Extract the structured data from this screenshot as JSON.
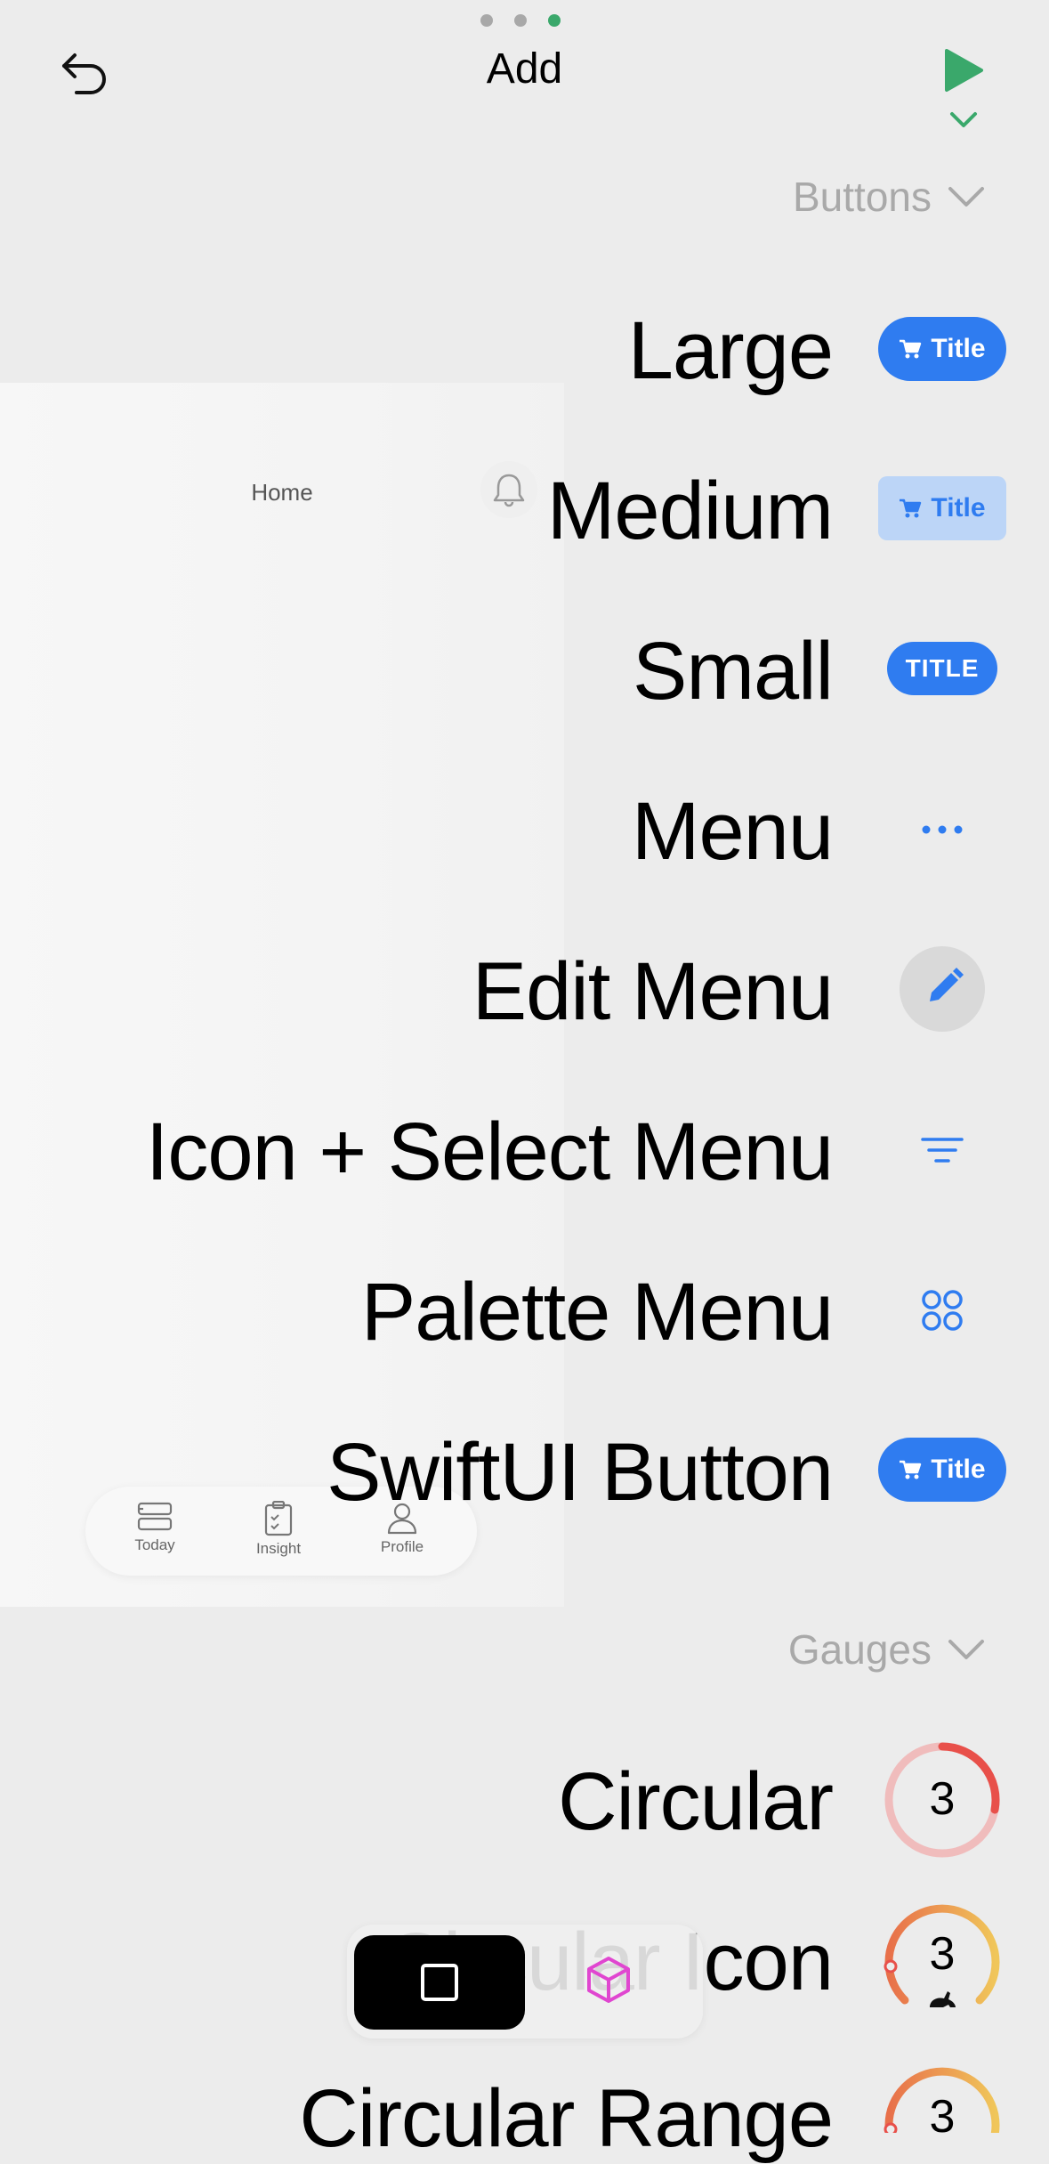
{
  "header": {
    "title": "Add"
  },
  "preview": {
    "home_label": "Home",
    "tabs": [
      {
        "label": "Today",
        "icon": "today-icon"
      },
      {
        "label": "Insight",
        "icon": "clipboard-icon"
      },
      {
        "label": "Profile",
        "icon": "person-icon"
      }
    ]
  },
  "sections": {
    "buttons": {
      "label": "Buttons"
    },
    "gauges": {
      "label": "Gauges"
    }
  },
  "rows": {
    "large": {
      "label": "Large",
      "control_text": "Title"
    },
    "medium": {
      "label": "Medium",
      "control_text": "Title"
    },
    "small": {
      "label": "Small",
      "control_text": "TITLE"
    },
    "menu": {
      "label": "Menu"
    },
    "edit_menu": {
      "label": "Edit Menu"
    },
    "icon_select_menu": {
      "label": "Icon + Select Menu"
    },
    "palette_menu": {
      "label": "Palette Menu"
    },
    "swiftui_button": {
      "label": "SwiftUI Button",
      "control_text": "Title"
    },
    "circular": {
      "label": "Circular",
      "value": "3"
    },
    "circular_icon": {
      "label": "Circular Icon",
      "visible_prefix": "C",
      "visible_suffix": "con",
      "value": "3"
    },
    "circular_range": {
      "label": "Circular Range",
      "value": "3"
    }
  },
  "colors": {
    "accent": "#2f7cf0",
    "run_green": "#3aa86b",
    "gauge_red": "#e8504a",
    "gauge_yellow": "#f0c65a",
    "cube_pink": "#e046d0"
  }
}
